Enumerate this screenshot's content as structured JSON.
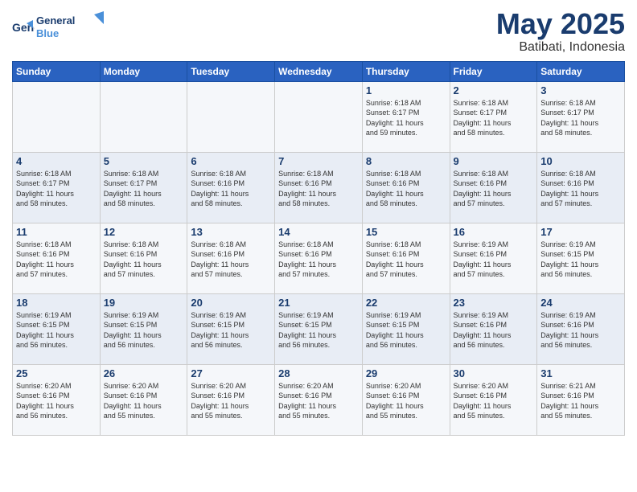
{
  "header": {
    "logo_line1": "General",
    "logo_line2": "Blue",
    "month": "May 2025",
    "location": "Batibati, Indonesia"
  },
  "days_of_week": [
    "Sunday",
    "Monday",
    "Tuesday",
    "Wednesday",
    "Thursday",
    "Friday",
    "Saturday"
  ],
  "weeks": [
    [
      {
        "day": "",
        "info": ""
      },
      {
        "day": "",
        "info": ""
      },
      {
        "day": "",
        "info": ""
      },
      {
        "day": "",
        "info": ""
      },
      {
        "day": "1",
        "info": "Sunrise: 6:18 AM\nSunset: 6:17 PM\nDaylight: 11 hours\nand 59 minutes."
      },
      {
        "day": "2",
        "info": "Sunrise: 6:18 AM\nSunset: 6:17 PM\nDaylight: 11 hours\nand 58 minutes."
      },
      {
        "day": "3",
        "info": "Sunrise: 6:18 AM\nSunset: 6:17 PM\nDaylight: 11 hours\nand 58 minutes."
      }
    ],
    [
      {
        "day": "4",
        "info": "Sunrise: 6:18 AM\nSunset: 6:17 PM\nDaylight: 11 hours\nand 58 minutes."
      },
      {
        "day": "5",
        "info": "Sunrise: 6:18 AM\nSunset: 6:17 PM\nDaylight: 11 hours\nand 58 minutes."
      },
      {
        "day": "6",
        "info": "Sunrise: 6:18 AM\nSunset: 6:16 PM\nDaylight: 11 hours\nand 58 minutes."
      },
      {
        "day": "7",
        "info": "Sunrise: 6:18 AM\nSunset: 6:16 PM\nDaylight: 11 hours\nand 58 minutes."
      },
      {
        "day": "8",
        "info": "Sunrise: 6:18 AM\nSunset: 6:16 PM\nDaylight: 11 hours\nand 58 minutes."
      },
      {
        "day": "9",
        "info": "Sunrise: 6:18 AM\nSunset: 6:16 PM\nDaylight: 11 hours\nand 57 minutes."
      },
      {
        "day": "10",
        "info": "Sunrise: 6:18 AM\nSunset: 6:16 PM\nDaylight: 11 hours\nand 57 minutes."
      }
    ],
    [
      {
        "day": "11",
        "info": "Sunrise: 6:18 AM\nSunset: 6:16 PM\nDaylight: 11 hours\nand 57 minutes."
      },
      {
        "day": "12",
        "info": "Sunrise: 6:18 AM\nSunset: 6:16 PM\nDaylight: 11 hours\nand 57 minutes."
      },
      {
        "day": "13",
        "info": "Sunrise: 6:18 AM\nSunset: 6:16 PM\nDaylight: 11 hours\nand 57 minutes."
      },
      {
        "day": "14",
        "info": "Sunrise: 6:18 AM\nSunset: 6:16 PM\nDaylight: 11 hours\nand 57 minutes."
      },
      {
        "day": "15",
        "info": "Sunrise: 6:18 AM\nSunset: 6:16 PM\nDaylight: 11 hours\nand 57 minutes."
      },
      {
        "day": "16",
        "info": "Sunrise: 6:19 AM\nSunset: 6:16 PM\nDaylight: 11 hours\nand 57 minutes."
      },
      {
        "day": "17",
        "info": "Sunrise: 6:19 AM\nSunset: 6:15 PM\nDaylight: 11 hours\nand 56 minutes."
      }
    ],
    [
      {
        "day": "18",
        "info": "Sunrise: 6:19 AM\nSunset: 6:15 PM\nDaylight: 11 hours\nand 56 minutes."
      },
      {
        "day": "19",
        "info": "Sunrise: 6:19 AM\nSunset: 6:15 PM\nDaylight: 11 hours\nand 56 minutes."
      },
      {
        "day": "20",
        "info": "Sunrise: 6:19 AM\nSunset: 6:15 PM\nDaylight: 11 hours\nand 56 minutes."
      },
      {
        "day": "21",
        "info": "Sunrise: 6:19 AM\nSunset: 6:15 PM\nDaylight: 11 hours\nand 56 minutes."
      },
      {
        "day": "22",
        "info": "Sunrise: 6:19 AM\nSunset: 6:15 PM\nDaylight: 11 hours\nand 56 minutes."
      },
      {
        "day": "23",
        "info": "Sunrise: 6:19 AM\nSunset: 6:16 PM\nDaylight: 11 hours\nand 56 minutes."
      },
      {
        "day": "24",
        "info": "Sunrise: 6:19 AM\nSunset: 6:16 PM\nDaylight: 11 hours\nand 56 minutes."
      }
    ],
    [
      {
        "day": "25",
        "info": "Sunrise: 6:20 AM\nSunset: 6:16 PM\nDaylight: 11 hours\nand 56 minutes."
      },
      {
        "day": "26",
        "info": "Sunrise: 6:20 AM\nSunset: 6:16 PM\nDaylight: 11 hours\nand 55 minutes."
      },
      {
        "day": "27",
        "info": "Sunrise: 6:20 AM\nSunset: 6:16 PM\nDaylight: 11 hours\nand 55 minutes."
      },
      {
        "day": "28",
        "info": "Sunrise: 6:20 AM\nSunset: 6:16 PM\nDaylight: 11 hours\nand 55 minutes."
      },
      {
        "day": "29",
        "info": "Sunrise: 6:20 AM\nSunset: 6:16 PM\nDaylight: 11 hours\nand 55 minutes."
      },
      {
        "day": "30",
        "info": "Sunrise: 6:20 AM\nSunset: 6:16 PM\nDaylight: 11 hours\nand 55 minutes."
      },
      {
        "day": "31",
        "info": "Sunrise: 6:21 AM\nSunset: 6:16 PM\nDaylight: 11 hours\nand 55 minutes."
      }
    ]
  ]
}
